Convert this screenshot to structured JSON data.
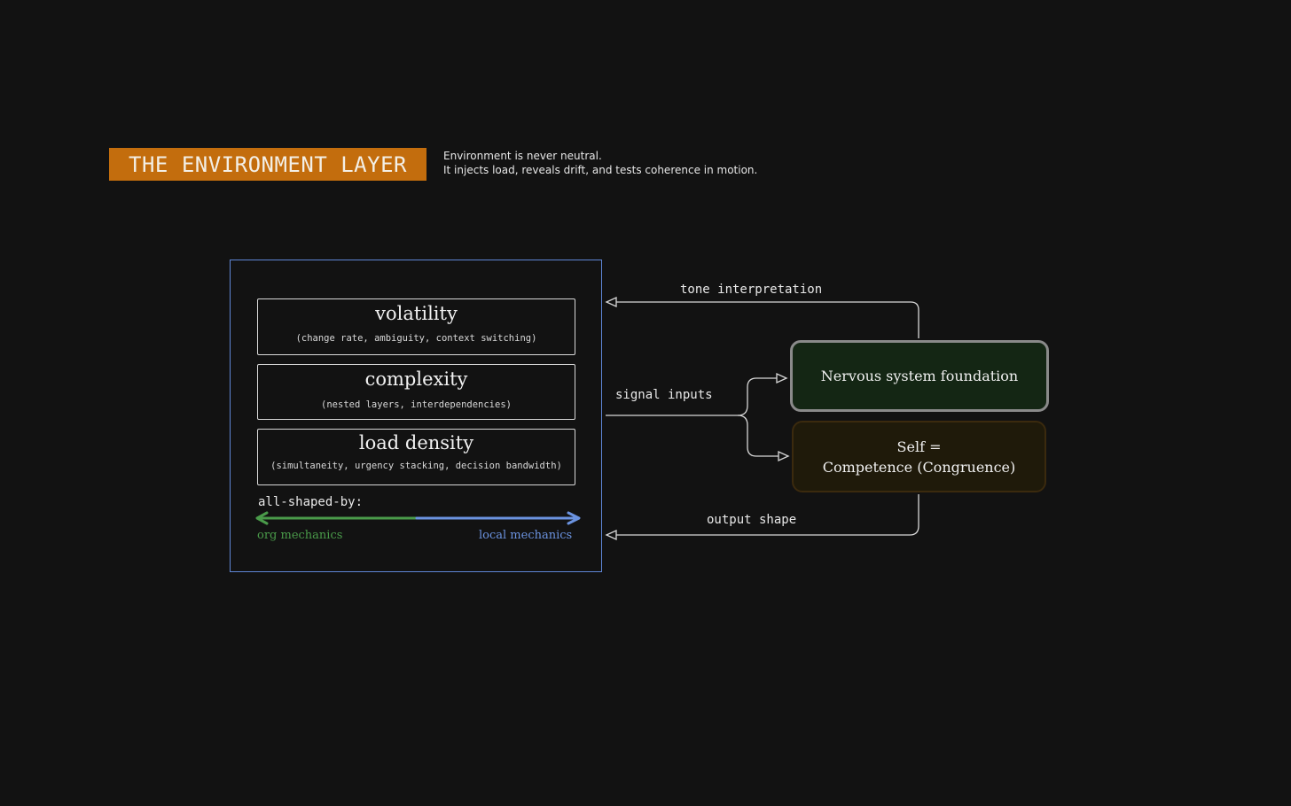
{
  "header": {
    "title": "THE ENVIRONMENT LAYER",
    "tagline_line1": "Environment is never neutral.",
    "tagline_line2": "It injects load, reveals drift, and tests coherence in motion."
  },
  "environment": {
    "factors": [
      {
        "title": "volatility",
        "detail": "(change rate, ambiguity, context switching)"
      },
      {
        "title": "complexity",
        "detail": "(nested layers, interdependencies)"
      },
      {
        "title": "load density",
        "detail": "(simultaneity, urgency stacking, decision bandwidth)"
      }
    ],
    "shaped_by_label": "all-shaped-by:",
    "spectrum_left": "org mechanics",
    "spectrum_right": "local mechanics"
  },
  "connectors": {
    "tone_interpretation": "tone interpretation",
    "signal_inputs": "signal inputs",
    "output_shape": "output shape"
  },
  "nodes": {
    "nervous_system": "Nervous system foundation",
    "self_line1": "Self =",
    "self_line2": "Competence (Congruence)"
  },
  "colors": {
    "title_badge": "#c36d0d",
    "frame_border": "#5f86d6",
    "org_mechanics": "#4a9b4a",
    "local_mechanics": "#6b93e0",
    "nervous_fill": "#142614",
    "self_fill": "#1f1a0a"
  }
}
